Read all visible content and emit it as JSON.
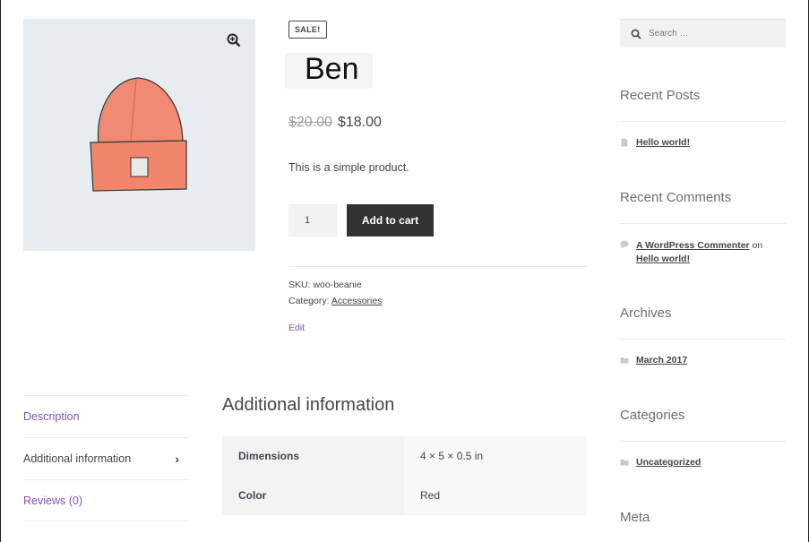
{
  "product": {
    "sale_badge": "SALE!",
    "title": "Ben",
    "old_price": "$20.00",
    "new_price": "$18.00",
    "short_description": "This is a simple product.",
    "quantity": "1",
    "add_to_cart_label": "Add to cart",
    "sku_label": "SKU:",
    "sku_value": "woo-beanie",
    "category_label": "Category:",
    "category_value": "Accessories",
    "edit_label": "Edit",
    "image_icon": "zoom-in-icon"
  },
  "tabs": [
    {
      "label": "Description"
    },
    {
      "label": "Additional information"
    },
    {
      "label": "Reviews (0)"
    }
  ],
  "additional_info": {
    "heading": "Additional information",
    "rows": [
      {
        "label": "Dimensions",
        "value": "4 × 5 × 0.5 in"
      },
      {
        "label": "Color",
        "value": "Red"
      }
    ]
  },
  "sidebar": {
    "search_placeholder": "Search …",
    "recent_posts": {
      "title": "Recent Posts",
      "items": [
        "Hello world!"
      ]
    },
    "recent_comments": {
      "title": "Recent Comments",
      "author": "A WordPress Commenter",
      "on": "on",
      "post": "Hello world!"
    },
    "archives": {
      "title": "Archives",
      "items": [
        "March 2017"
      ]
    },
    "categories": {
      "title": "Categories",
      "items": [
        "Uncategorized"
      ]
    },
    "meta": {
      "title": "Meta"
    }
  },
  "colors": {
    "accent": "#7f54b3",
    "button": "#333333",
    "text": "#43454b"
  }
}
